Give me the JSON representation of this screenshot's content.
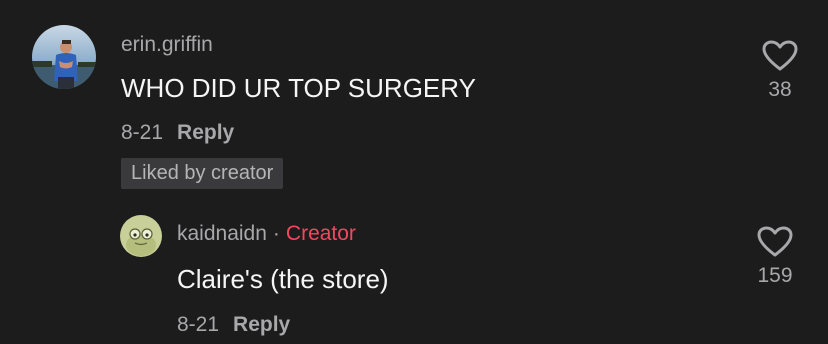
{
  "comments": [
    {
      "username": "erin.griffin",
      "text": "WHO DID UR TOP SURGERY",
      "date": "8-21",
      "reply_label": "Reply",
      "badge": "Liked by creator",
      "likes": "38"
    },
    {
      "username": "kaidnaidn",
      "separator": "·",
      "creator_label": "Creator",
      "text": "Claire's (the store)",
      "date": "8-21",
      "reply_label": "Reply",
      "likes": "159"
    }
  ],
  "colors": {
    "background": "#1c1c1d",
    "creator_accent": "#f2475e",
    "muted_text": "#a8a8aa",
    "badge_bg": "#3a3a3c"
  },
  "icons": {
    "like": "heart-outline-icon"
  }
}
